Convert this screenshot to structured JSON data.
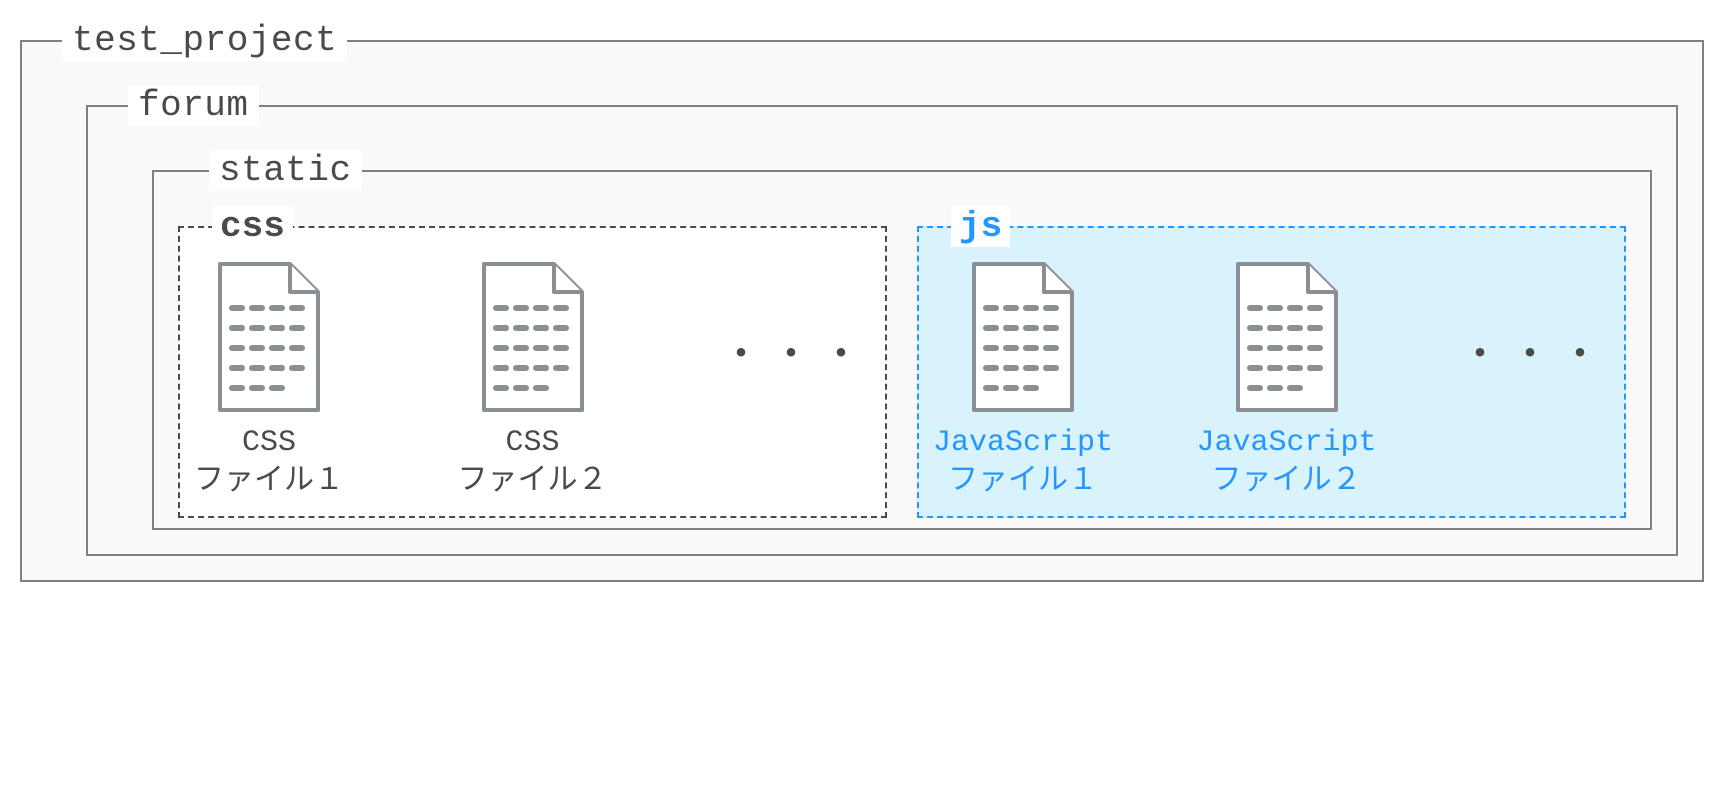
{
  "project": {
    "label": "test_project",
    "forum": {
      "label": "forum",
      "static": {
        "label": "static",
        "css_folder": {
          "label": "css",
          "files": [
            {
              "name_line1": "CSS",
              "name_line2": "ファイル１"
            },
            {
              "name_line1": "CSS",
              "name_line2": "ファイル２"
            }
          ],
          "ellipsis": "・・・"
        },
        "js_folder": {
          "label": "js",
          "files": [
            {
              "name_line1": "JavaScript",
              "name_line2": "ファイル１"
            },
            {
              "name_line1": "JavaScript",
              "name_line2": "ファイル２"
            }
          ],
          "ellipsis": "・・・"
        }
      }
    }
  },
  "colors": {
    "neutral": "#4a4a4a",
    "highlight": "#2596ff",
    "highlight_bg": "#d9f3fc"
  }
}
